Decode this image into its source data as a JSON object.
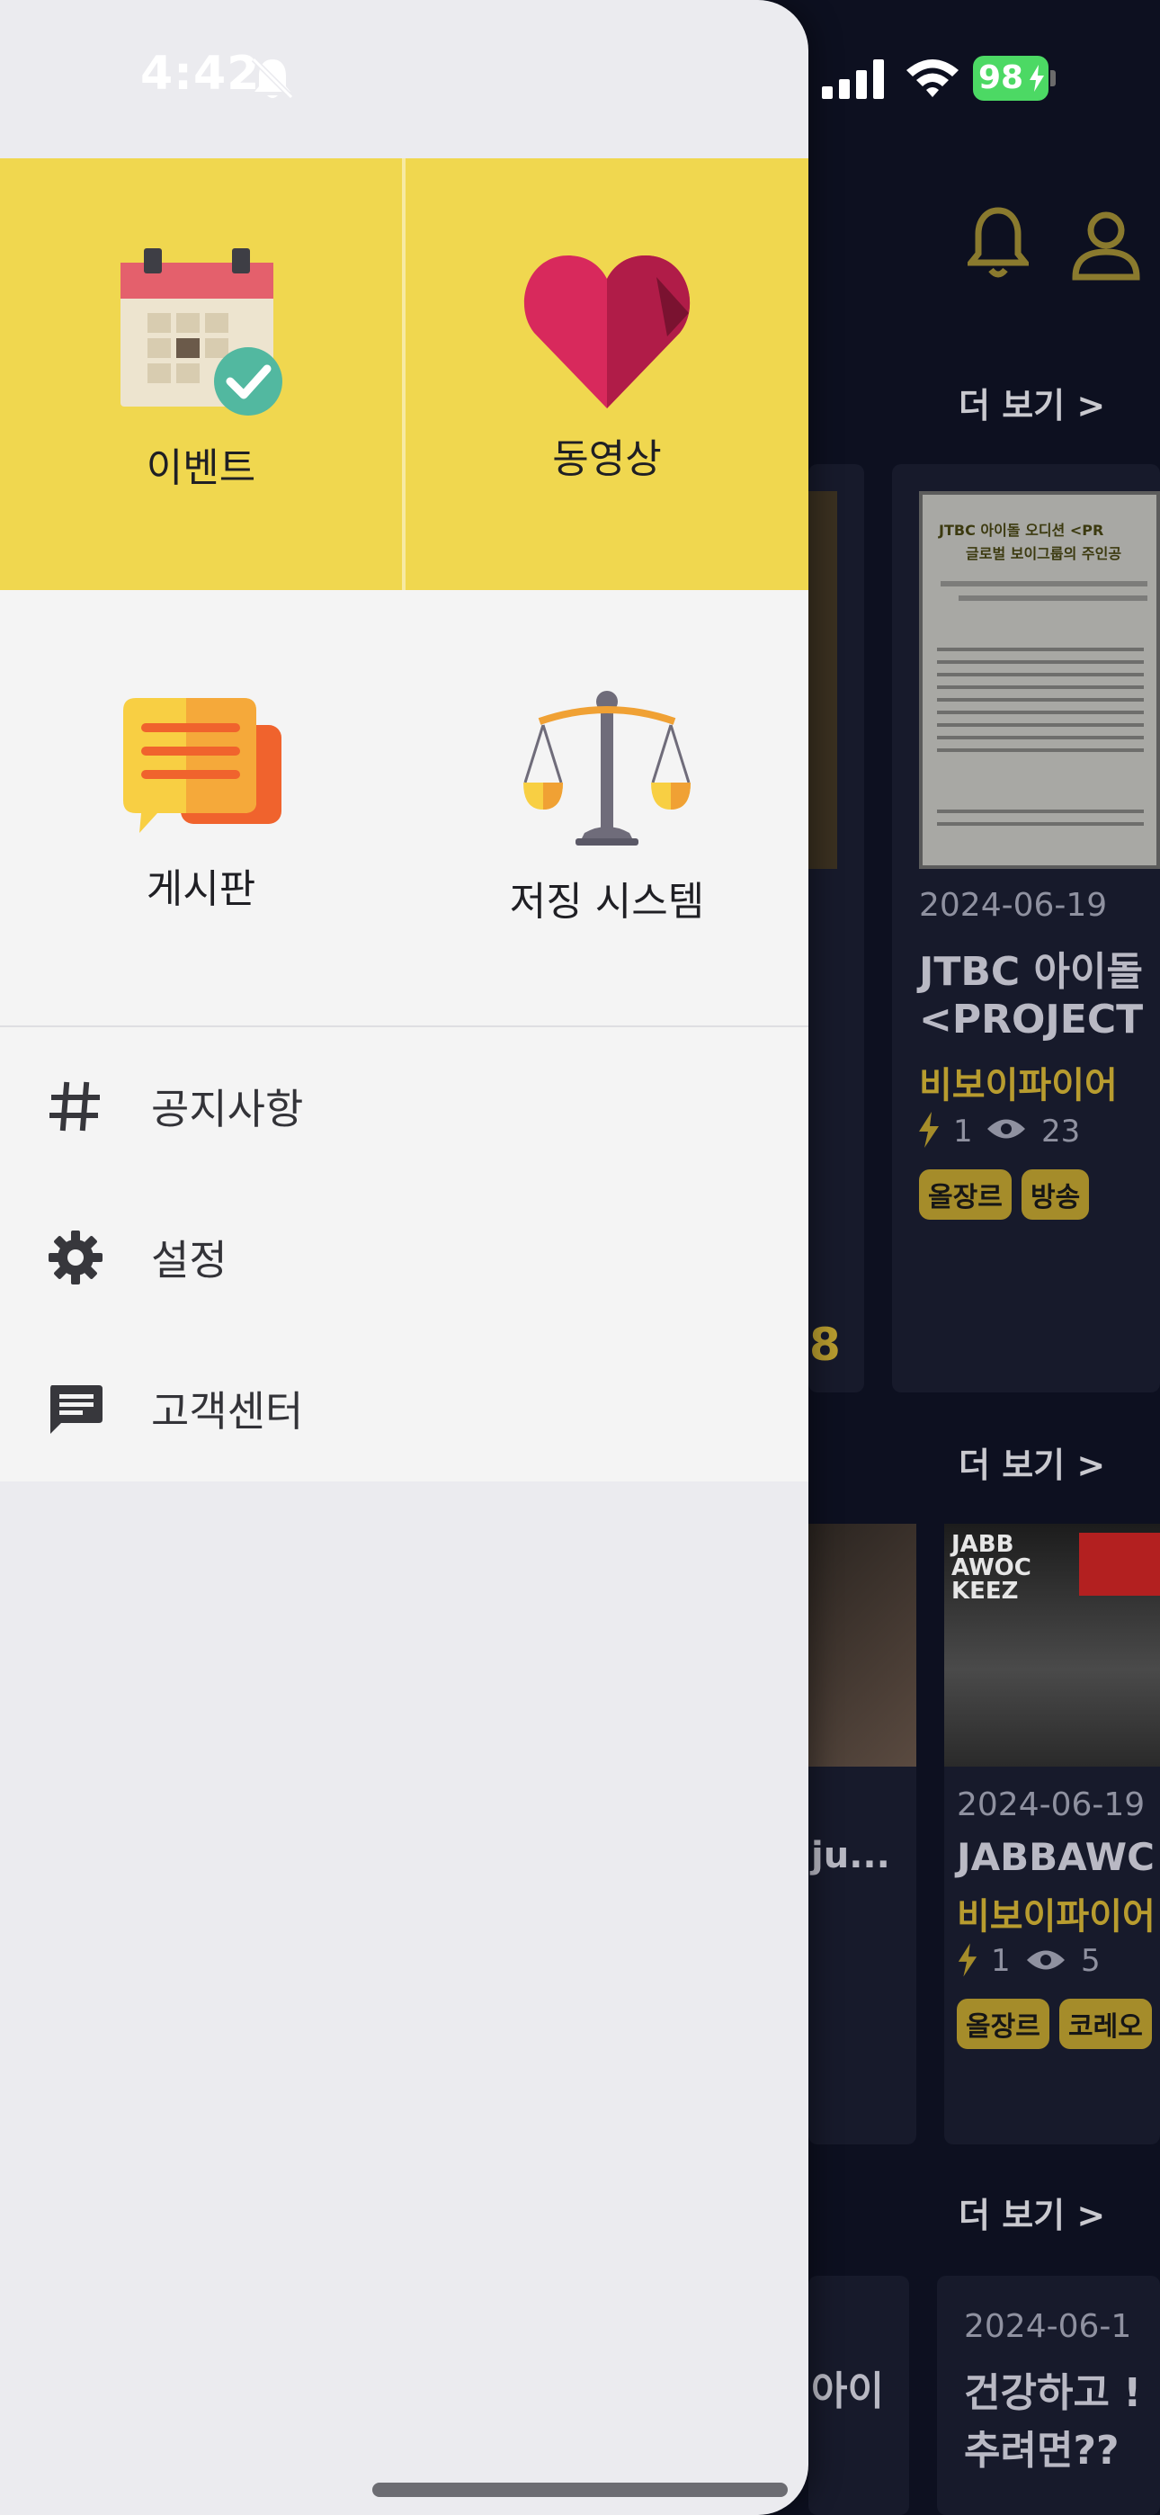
{
  "status_bar": {
    "time": "4:42",
    "battery": "98"
  },
  "background": {
    "more_label": "더 보기 >",
    "card1": {
      "date": "2024-06-19",
      "title_line1": "JTBC 아이돌",
      "title_line2": "<PROJECT",
      "author": "비보이파이어",
      "likes": "1",
      "views": "23",
      "tags": [
        "올장르",
        "방송"
      ],
      "poster_title": "JTBC 아이돌 오디션 <PR",
      "poster_sub": "글로벌 보이그룹의 주인공"
    },
    "partial_number": "8",
    "partial_text": "ju...",
    "card2": {
      "date": "2024-06-19",
      "title": "JABBAWC",
      "author": "비보이파이어",
      "likes": "1",
      "views": "5",
      "tags": [
        "올장르",
        "코레오"
      ],
      "poster_text": "JABB AWOC KEEZ"
    },
    "partial_text2": "아이",
    "card3": {
      "date": "2024-06-1",
      "title_line1": "건강하고 !",
      "title_line2": "추려면??"
    }
  },
  "drawer": {
    "tiles": [
      {
        "label": "이벤트",
        "icon": "calendar-check-icon"
      },
      {
        "label": "동영상",
        "icon": "heart-icon"
      },
      {
        "label": "게시판",
        "icon": "chat-bubbles-icon"
      },
      {
        "label": "저징 시스템",
        "icon": "scales-icon"
      }
    ],
    "menu": [
      {
        "label": "공지사항",
        "icon": "hash-icon"
      },
      {
        "label": "설정",
        "icon": "gear-icon"
      },
      {
        "label": "고객센터",
        "icon": "message-icon"
      }
    ]
  }
}
